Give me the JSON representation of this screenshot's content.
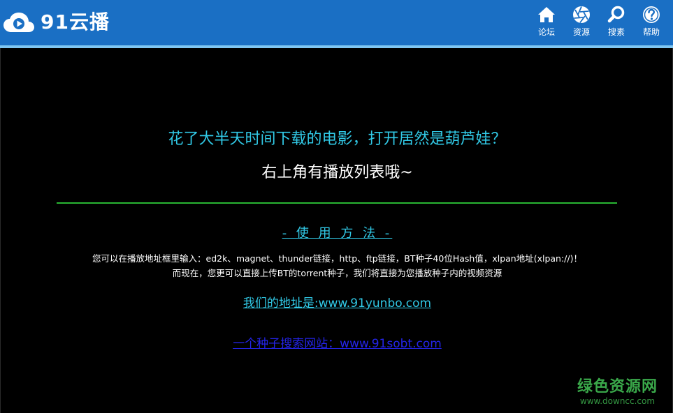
{
  "app": {
    "name": "91云播"
  },
  "nav": {
    "items": [
      {
        "label": "论坛",
        "icon": "home-icon"
      },
      {
        "label": "资源",
        "icon": "aperture-icon"
      },
      {
        "label": "搜素",
        "icon": "search-icon"
      },
      {
        "label": "帮助",
        "icon": "help-icon"
      }
    ]
  },
  "content": {
    "headline": "花了大半天时间下载的电影，打开居然是葫芦娃？",
    "subline": "右上角有播放列表哦~",
    "usage_title": "- 使 用 方 法 -",
    "usage_line1": "您可以在播放地址框里输入：ed2k、magnet、thunder链接，http、ftp链接，BT种子40位Hash值，xlpan地址(xlpan://)！",
    "usage_line2": "而现在，您更可以直接上传BT的torrent种子，我们将直接为您播放种子内的视频资源",
    "site_link": "我们的地址是:www.91yunbo.com",
    "search_link": "一个种子搜索网站：www.91sobt.com"
  },
  "watermark": {
    "title": "绿色资源网",
    "url": "www.downcc.com"
  },
  "colors": {
    "topbar": "#1a6fc4",
    "accent_cyan": "#31c9e6",
    "divider_green": "#29b733",
    "link_blue": "#2424e8"
  }
}
